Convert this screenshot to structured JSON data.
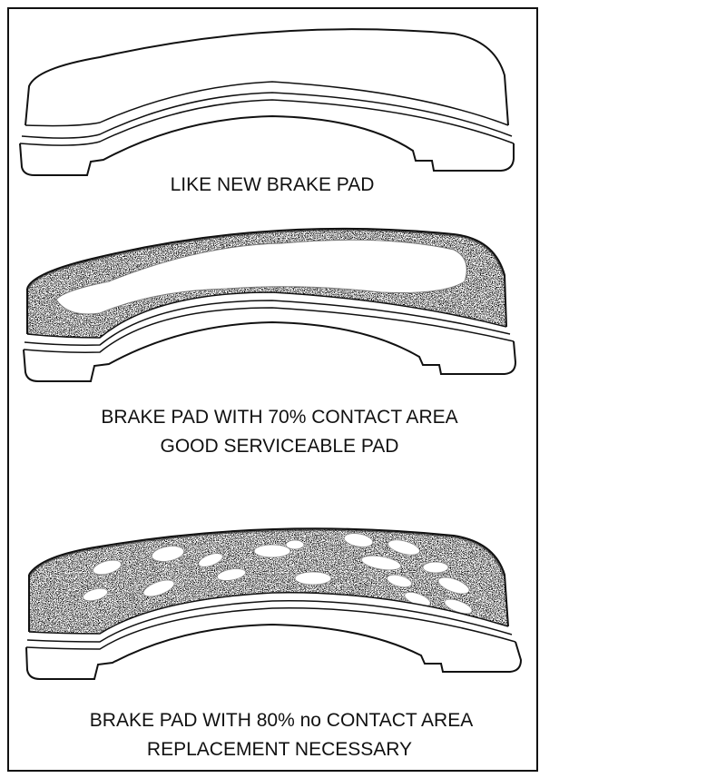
{
  "panels": [
    {
      "caption_lines": [
        "LIKE NEW BRAKE PAD"
      ]
    },
    {
      "caption_lines": [
        "BRAKE PAD WITH 70% CONTACT AREA",
        "GOOD SERVICEABLE PAD"
      ]
    },
    {
      "caption_lines": [
        "BRAKE PAD WITH 80% no CONTACT AREA",
        "REPLACEMENT NECESSARY"
      ]
    }
  ],
  "colors": {
    "ink": "#111111",
    "paper": "#ffffff"
  }
}
